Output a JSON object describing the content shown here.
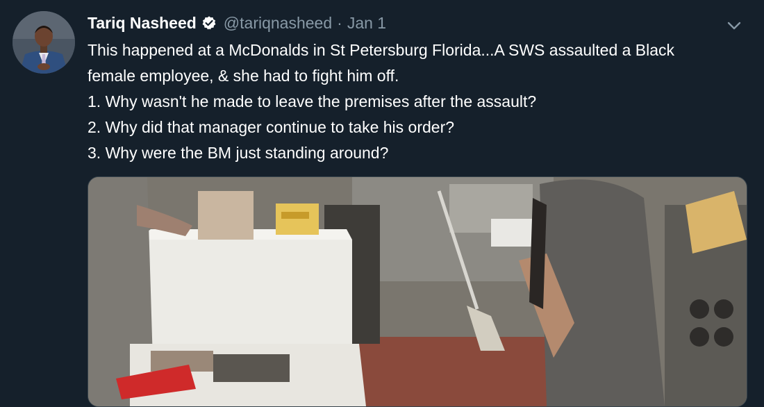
{
  "tweet": {
    "author_name": "Tariq Nasheed",
    "handle": "@tariqnasheed",
    "separator": "·",
    "date": "Jan 1",
    "lines": [
      "This happened at a McDonalds in St Petersburg Florida...A SWS assaulted a Black",
      "female employee, & she had to fight him off.",
      "1. Why wasn't he made to leave the premises after the assault?",
      "2. Why did that manager continue to take his order?",
      "3. Why were the BM just standing around?"
    ],
    "icons": {
      "verified": "verified-badge-icon",
      "menu": "chevron-down-icon"
    }
  },
  "colors": {
    "background": "#15202b",
    "text": "#ffffff",
    "muted": "#8899a6",
    "border": "#38444d"
  }
}
